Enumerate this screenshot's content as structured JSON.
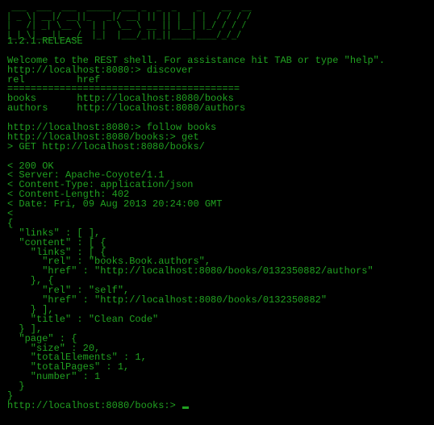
{
  "banner": {
    "art": " ___  ___  ___  _____  ___ _  _  _    _    __  __\n| _ \\| __|/ __||_   _|/ __| || || |  | |  / / / /\n|   /| _| \\__ \\  | |  \\__ \\ __ || |__| |_/ / / / \n|_|_\\|___||___/  |_|  |___/_||_||____|____/_/_/  "
  },
  "terminal": {
    "lines": [
      "1.2.1.RELEASE",
      "",
      "Welcome to the REST shell. For assistance hit TAB or type \"help\".",
      "http://localhost:8080:> discover",
      "rel         href",
      "========================================",
      "books       http://localhost:8080/books",
      "authors     http://localhost:8080/authors",
      "",
      "http://localhost:8080:> follow books",
      "http://localhost:8080/books:> get",
      "> GET http://localhost:8080/books/",
      "",
      "< 200 OK",
      "< Server: Apache-Coyote/1.1",
      "< Content-Type: application/json",
      "< Content-Length: 402",
      "< Date: Fri, 09 Aug 2013 20:24:00 GMT",
      "<",
      "{",
      "  \"links\" : [ ],",
      "  \"content\" : [ {",
      "    \"links\" : [ {",
      "      \"rel\" : \"books.Book.authors\",",
      "      \"href\" : \"http://localhost:8080/books/0132350882/authors\"",
      "    }, {",
      "      \"rel\" : \"self\",",
      "      \"href\" : \"http://localhost:8080/books/0132350882\"",
      "    } ],",
      "    \"title\" : \"Clean Code\"",
      "  } ],",
      "  \"page\" : {",
      "    \"size\" : 20,",
      "    \"totalElements\" : 1,",
      "    \"totalPages\" : 1,",
      "    \"number\" : 1",
      "  }",
      "}"
    ],
    "prompt": "http://localhost:8080/books:> "
  },
  "colors": {
    "background": "#000000",
    "text": "#21a121"
  }
}
